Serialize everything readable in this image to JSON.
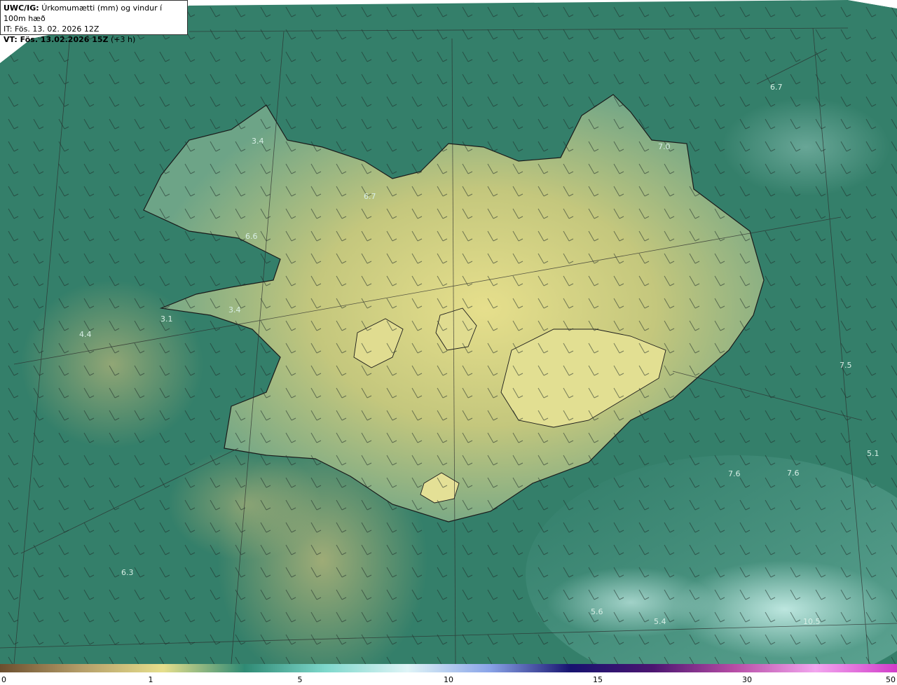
{
  "header": {
    "model": "UWC/IG:",
    "title": "Úrkomumætti (mm) og vindur í 100m hæð",
    "issue_time": "IT: Fös. 13. 02. 2026 12Z",
    "valid_label": "VT: Fös. 13.02.2026 15Z",
    "valid_offset": "(+3 h)"
  },
  "values": [
    {
      "text": "6.7"
    },
    {
      "text": "3.4"
    },
    {
      "text": "7.0"
    },
    {
      "text": "6.7"
    },
    {
      "text": "6.6"
    },
    {
      "text": "3.4"
    },
    {
      "text": "3.1"
    },
    {
      "text": "4.4"
    },
    {
      "text": "7.5"
    },
    {
      "text": "5.1"
    },
    {
      "text": "7.6"
    },
    {
      "text": "7.6"
    },
    {
      "text": "6.3"
    },
    {
      "text": "5.6"
    },
    {
      "text": "5.4"
    },
    {
      "text": "10.5"
    }
  ],
  "colorbar": {
    "ticks": [
      "0",
      "1",
      "5",
      "10",
      "15",
      "30",
      "50"
    ],
    "colors": [
      "#6b4e2e",
      "#b59e69",
      "#e6df8c",
      "#2f8a74",
      "#7fd8cc",
      "#dff4f7",
      "#8aa4e8",
      "#17136f",
      "#4b1570",
      "#b64ca5",
      "#f2a6ee",
      "#d13cc9"
    ]
  }
}
